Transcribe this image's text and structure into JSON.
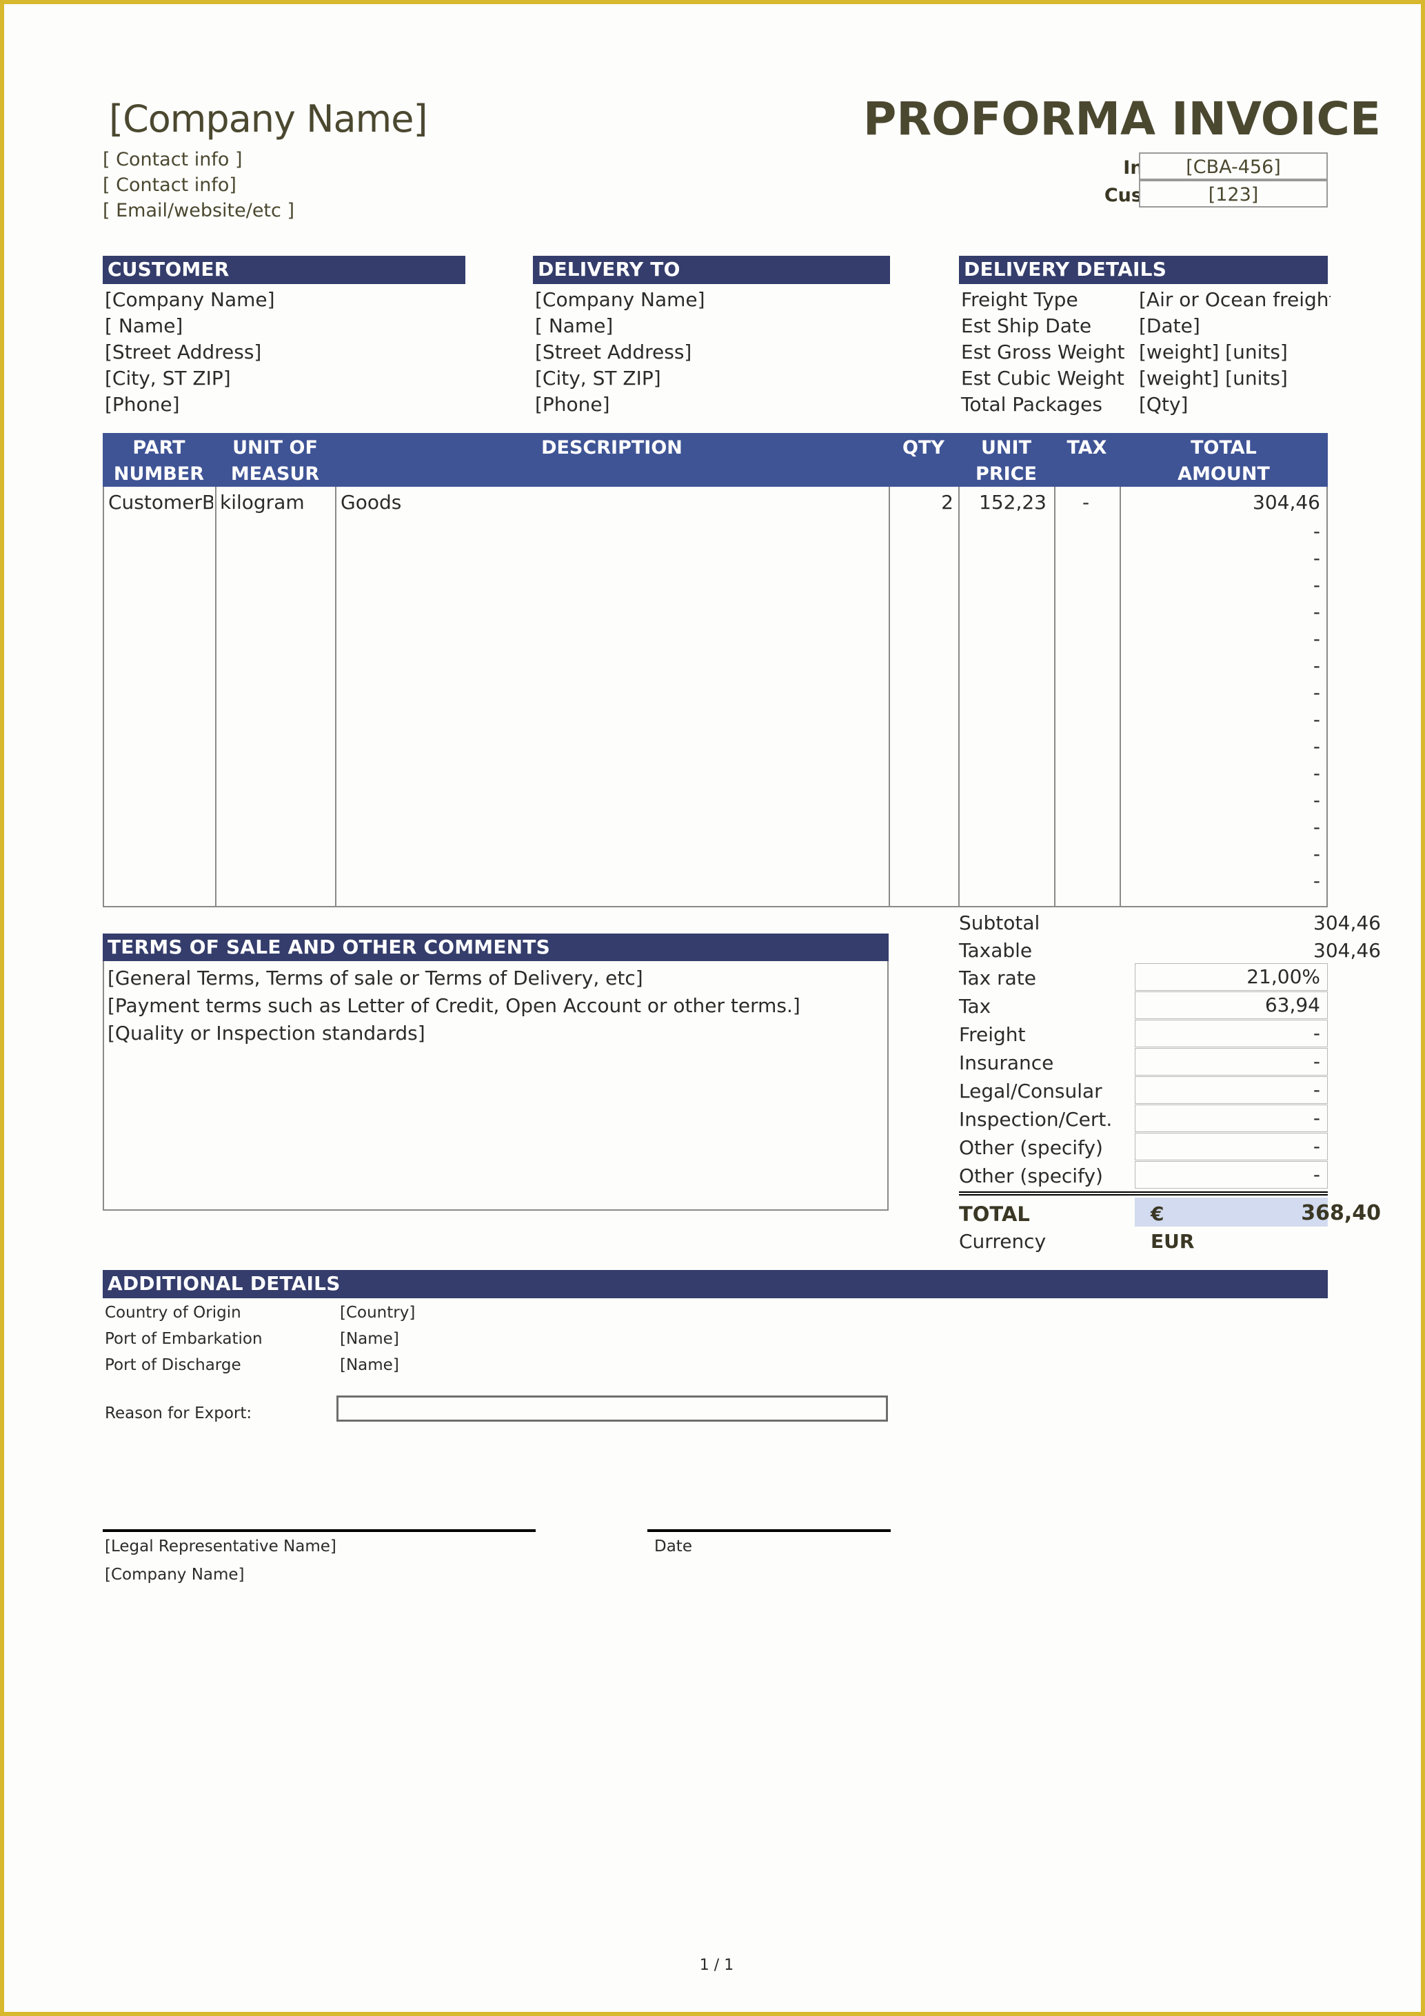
{
  "header": {
    "company_name": "[Company Name]",
    "contact_lines": [
      "[ Contact info ]",
      "[ Contact info]",
      "[ Email/website/etc ]"
    ],
    "doc_title": "PROFORMA INVOICE",
    "invoice_nr_label": "Invoice Nr.",
    "invoice_nr_value": "[CBA-456]",
    "customer_id_label": "Customer ID",
    "customer_id_value": "[123]"
  },
  "customer": {
    "band": "CUSTOMER",
    "lines": [
      "[Company Name]",
      "[ Name]",
      "[Street Address]",
      "[City, ST  ZIP]",
      "[Phone]"
    ]
  },
  "delivery_to": {
    "band": "DELIVERY TO",
    "lines": [
      "[Company Name]",
      "[ Name]",
      "[Street Address]",
      "[City, ST  ZIP]",
      "[Phone]"
    ]
  },
  "delivery_details": {
    "band": "DELIVERY DETAILS",
    "rows": [
      {
        "label": "Freight Type",
        "value": "[Air or Ocean freight]"
      },
      {
        "label": "Est Ship Date",
        "value": "[Date]"
      },
      {
        "label": "Est Gross Weight",
        "value": "[weight] [units]"
      },
      {
        "label": "Est Cubic Weight",
        "value": "[weight] [units]"
      },
      {
        "label": "Total Packages",
        "value": "[Qty]"
      }
    ]
  },
  "items_table": {
    "columns": [
      "PART\nNUMBER",
      "UNIT OF\nMEASUR",
      "DESCRIPTION",
      "QTY",
      "UNIT\nPRICE",
      "TAX",
      "TOTAL\nAMOUNT"
    ],
    "rows": [
      {
        "part_number": "CustomerBOX",
        "unit_of_measure": "kilogram",
        "description": "Goods",
        "qty": "2",
        "unit_price": "152,23",
        "tax": "-",
        "total_amount": "304,46"
      }
    ],
    "empty_row_placeholder": "-",
    "empty_row_count": 14
  },
  "terms": {
    "band": "TERMS OF SALE AND OTHER COMMENTS",
    "lines": [
      "[General Terms, Terms of sale or Terms of Delivery, etc]",
      "[Payment terms such as Letter of Credit, Open Account or other terms.]",
      "[Quality or Inspection standards]"
    ]
  },
  "totals": {
    "plain_rows": [
      {
        "label": "Subtotal",
        "value": "304,46"
      },
      {
        "label": "Taxable",
        "value": "304,46"
      }
    ],
    "boxed_rows": [
      {
        "label": "Tax rate",
        "value": "21,00%"
      },
      {
        "label": "Tax",
        "value": "63,94"
      },
      {
        "label": "Freight",
        "value": "-"
      },
      {
        "label": "Insurance",
        "value": "-"
      },
      {
        "label": "Legal/Consular",
        "value": "-"
      },
      {
        "label": "Inspection/Cert.",
        "value": "-"
      },
      {
        "label": "Other (specify)",
        "value": "-"
      },
      {
        "label": "Other (specify)",
        "value": "-"
      }
    ],
    "total_label": "TOTAL",
    "total_currency_symbol": "€",
    "total_value": "368,40",
    "currency_label": "Currency",
    "currency_value": "EUR"
  },
  "additional_details": {
    "band": "ADDITIONAL DETAILS",
    "rows": [
      {
        "label": "Country of Origin",
        "value": "[Country]"
      },
      {
        "label": "Port of Embarkation",
        "value": "[Name]"
      },
      {
        "label": "Port of Discharge",
        "value": "[Name]"
      }
    ],
    "reason_label": "Reason for Export:",
    "reason_value": ""
  },
  "signature": {
    "rep_name": "[Legal Representative Name]",
    "company_name": "[Company Name]",
    "date_label": "Date"
  },
  "footer": {
    "page_indicator": "1 / 1"
  },
  "colors": {
    "band_navy": "#343d6b",
    "table_header_blue": "#3f5495",
    "title_olive": "#4b4830",
    "total_highlight": "#d2dbef",
    "page_border_gold": "#d8b92e"
  }
}
